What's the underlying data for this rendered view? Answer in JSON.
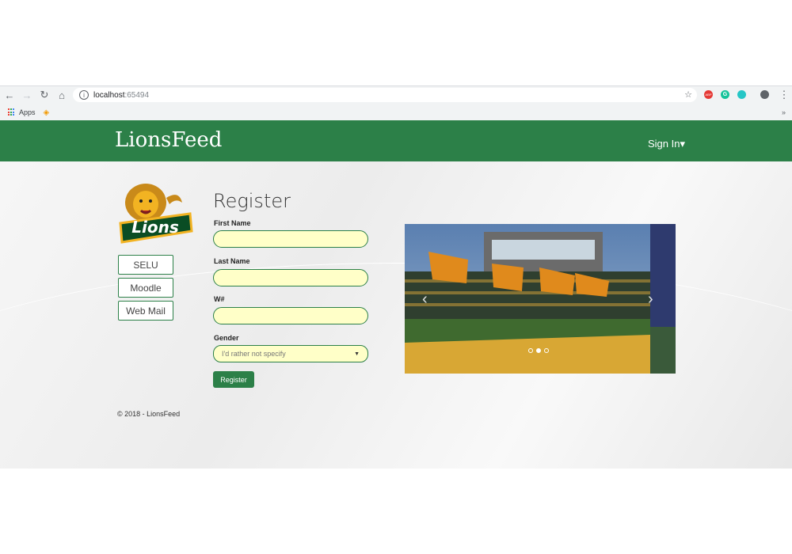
{
  "browser": {
    "url_host": "localhost",
    "url_port": ":65494",
    "bookmarks": {
      "apps_label": "Apps"
    },
    "overflow": "»",
    "ext_abp": "ABP",
    "ext_g": "G"
  },
  "site": {
    "brand": "LionsFeed",
    "nav": {
      "signin": "Sign In▾"
    },
    "logo_text": "Lions",
    "sidebar_links": [
      {
        "label": "SELU"
      },
      {
        "label": "Moodle"
      },
      {
        "label": "Web Mail"
      }
    ],
    "form": {
      "title": "Register",
      "first_name_label": "First Name",
      "last_name_label": "Last Name",
      "w_label": "W#",
      "gender_label": "Gender",
      "gender_value": "I'd rather not specify",
      "submit_label": "Register"
    },
    "carousel": {
      "active_index": 2,
      "count": 3
    },
    "footer": "© 2018 - LionsFeed"
  },
  "colors": {
    "brand_green": "#2c8048",
    "input_bg": "#ffffc8"
  }
}
